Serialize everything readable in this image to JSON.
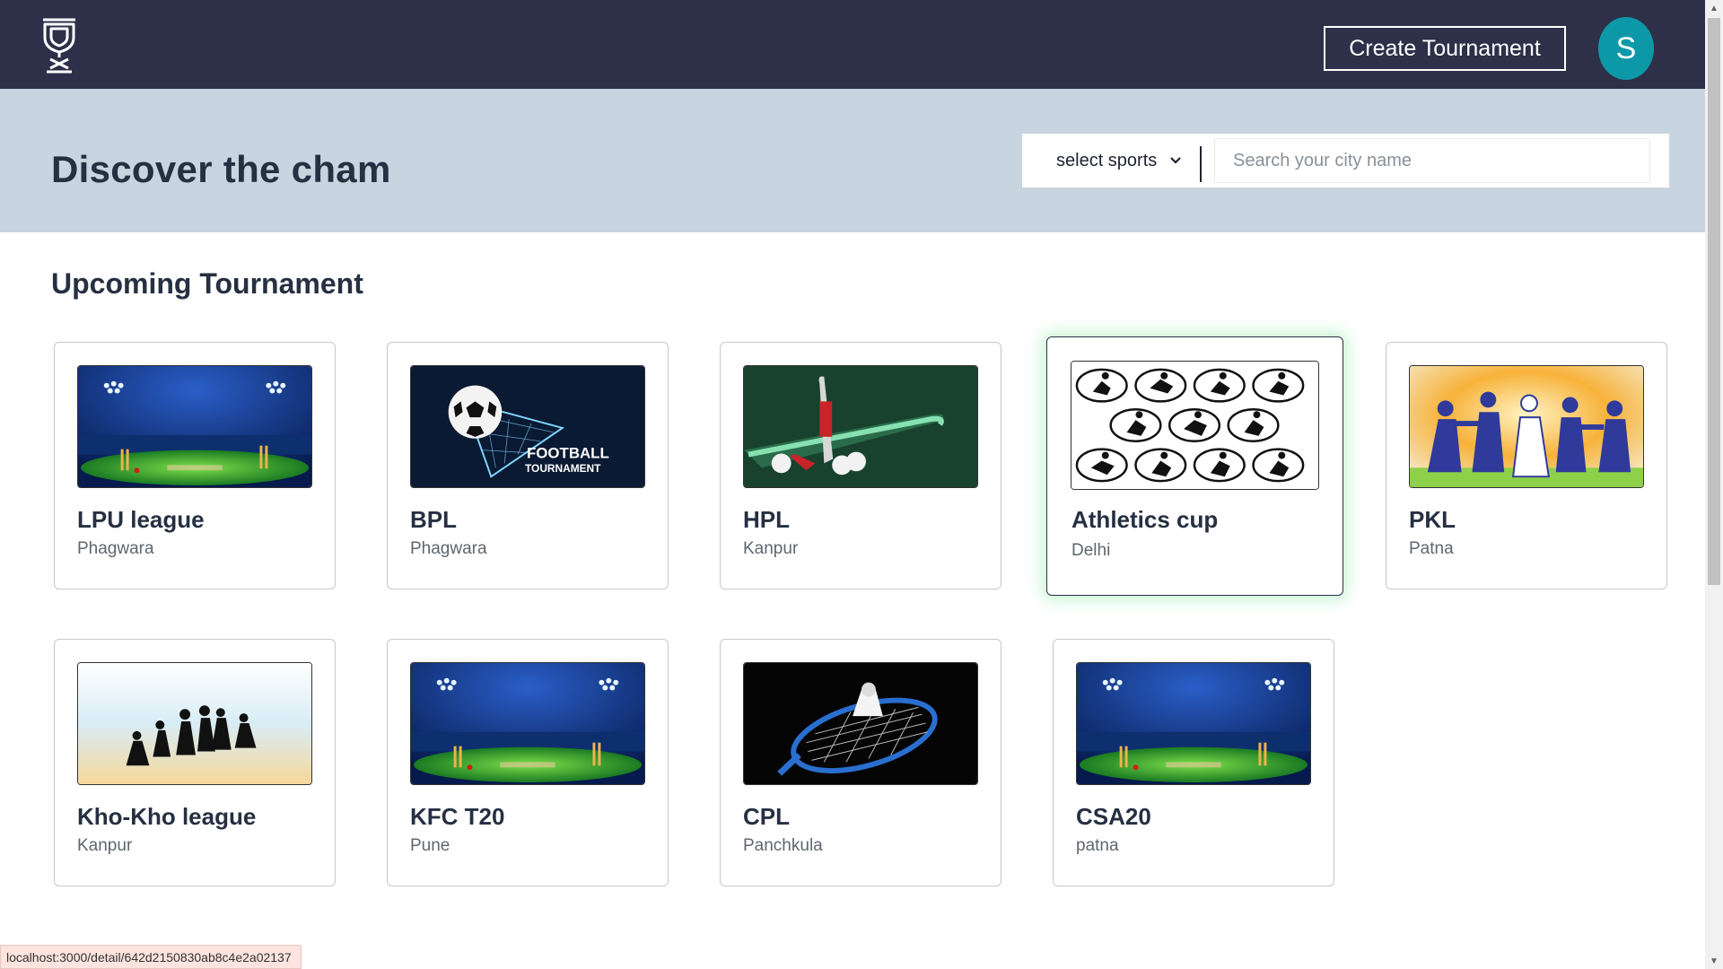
{
  "navbar": {
    "create_label": "Create Tournament",
    "avatar_initial": "S"
  },
  "hero": {
    "title": "Discover the cham",
    "select_label": "select sports",
    "search_placeholder": "Search your city name"
  },
  "section": {
    "title": "Upcoming Tournament"
  },
  "tournaments": [
    {
      "name": "LPU league",
      "city": "Phagwara",
      "image": "cricket-stadium"
    },
    {
      "name": "BPL",
      "city": "Phagwara",
      "image": "football-tournament"
    },
    {
      "name": "HPL",
      "city": "Kanpur",
      "image": "hockey-sticks"
    },
    {
      "name": "Athletics cup",
      "city": "Delhi",
      "image": "athletics-icons"
    },
    {
      "name": "PKL",
      "city": "Patna",
      "image": "kabaddi"
    },
    {
      "name": "Kho-Kho league",
      "city": "Kanpur",
      "image": "kho-kho-silhouettes"
    },
    {
      "name": "KFC T20",
      "city": "Pune",
      "image": "cricket-stadium"
    },
    {
      "name": "CPL",
      "city": "Panchkula",
      "image": "badminton-racket"
    },
    {
      "name": "CSA20",
      "city": "patna",
      "image": "cricket-stadium"
    }
  ],
  "football_art_text": [
    "FOOTBALL",
    "TOURNAMENT"
  ],
  "status_url": "localhost:3000/detail/642d2150830ab8c4e2a02137",
  "colors": {
    "navbar": "#2d3048",
    "hero": "#c8d5e0",
    "avatar": "#0d98a7",
    "hover_glow": "#78e696"
  }
}
